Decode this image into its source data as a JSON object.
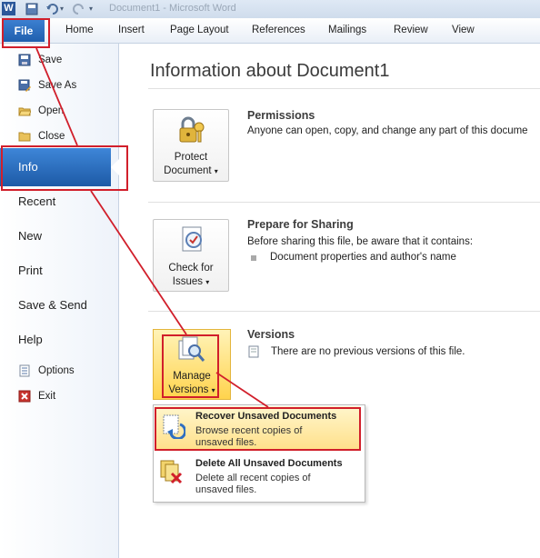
{
  "title_bar": {
    "app_icon_letter": "W",
    "title": "Document1 - Microsoft Word"
  },
  "ribbon": {
    "file_tab": "File",
    "tabs": [
      "Home",
      "Insert",
      "Page Layout",
      "References",
      "Mailings",
      "Review",
      "View"
    ]
  },
  "backstage_nav": {
    "small_items": [
      {
        "label": "Save",
        "icon": "save-icon"
      },
      {
        "label": "Save As",
        "icon": "save-as-icon"
      },
      {
        "label": "Open",
        "icon": "open-folder-icon"
      },
      {
        "label": "Close",
        "icon": "close-folder-icon"
      }
    ],
    "selected": "Info",
    "big_items": [
      "Recent",
      "New",
      "Print",
      "Save & Send",
      "Help"
    ],
    "bottom_items": [
      {
        "label": "Options",
        "icon": "options-icon"
      },
      {
        "label": "Exit",
        "icon": "exit-icon"
      }
    ]
  },
  "main": {
    "heading": "Information about Document1",
    "permissions": {
      "button_line1": "Protect",
      "button_line2": "Document",
      "title": "Permissions",
      "description": "Anyone can open, copy, and change any part of this docume"
    },
    "sharing": {
      "button_line1": "Check for",
      "button_line2": "Issues",
      "title": "Prepare for Sharing",
      "description": "Before sharing this file, be aware that it contains:",
      "bullet": "Document properties and author's name"
    },
    "versions": {
      "button_line1": "Manage",
      "button_line2": "Versions",
      "title": "Versions",
      "description": "There are no previous versions of this file."
    }
  },
  "versions_menu": {
    "items": [
      {
        "title": "Recover Unsaved Documents",
        "desc_line1": "Browse recent copies of",
        "desc_line2": "unsaved files.",
        "highlighted": true
      },
      {
        "title": "Delete All Unsaved Documents",
        "desc_line1": "Delete all recent copies of",
        "desc_line2": "unsaved files.",
        "highlighted": false
      }
    ]
  },
  "colors": {
    "accent_blue": "#1f5fae",
    "annotation_red": "#d11f2b",
    "highlight_yellow": "#ffd34d"
  }
}
